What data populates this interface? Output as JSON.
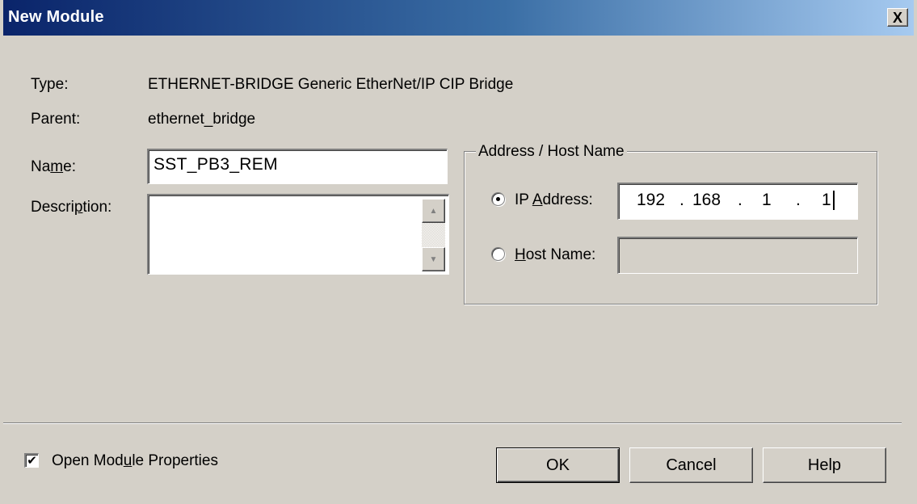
{
  "window": {
    "title": "New Module",
    "close_glyph": "X"
  },
  "fields": {
    "type_label": "Type:",
    "type_value": "ETHERNET-BRIDGE Generic EtherNet/IP CIP Bridge",
    "parent_label": "Parent:",
    "parent_value": "ethernet_bridge",
    "name_label_pre": "Na",
    "name_label_ul": "m",
    "name_label_post": "e:",
    "name_value": "SST_PB3_REM",
    "description_label_pre": "Descri",
    "description_label_ul": "p",
    "description_label_post": "tion:",
    "description_value": ""
  },
  "address_group": {
    "title": "Address / Host Name",
    "ip_option_pre": "IP ",
    "ip_option_ul": "A",
    "ip_option_post": "ddress:",
    "ip_selected": true,
    "ip_octets": [
      "192",
      "168",
      "1",
      "1"
    ],
    "ip_dot": ".",
    "host_option_ul": "H",
    "host_option_post": "ost Name:",
    "host_value": ""
  },
  "footer": {
    "open_props_pre": "Open Mod",
    "open_props_ul": "u",
    "open_props_post": "le Properties",
    "open_props_checked": true,
    "check_glyph": "✔",
    "ok_label": "OK",
    "cancel_label": "Cancel",
    "help_label": "Help"
  },
  "colors": {
    "dialog_bg": "#d4d0c8",
    "title_start": "#0a246a",
    "title_end": "#a6caf0"
  }
}
